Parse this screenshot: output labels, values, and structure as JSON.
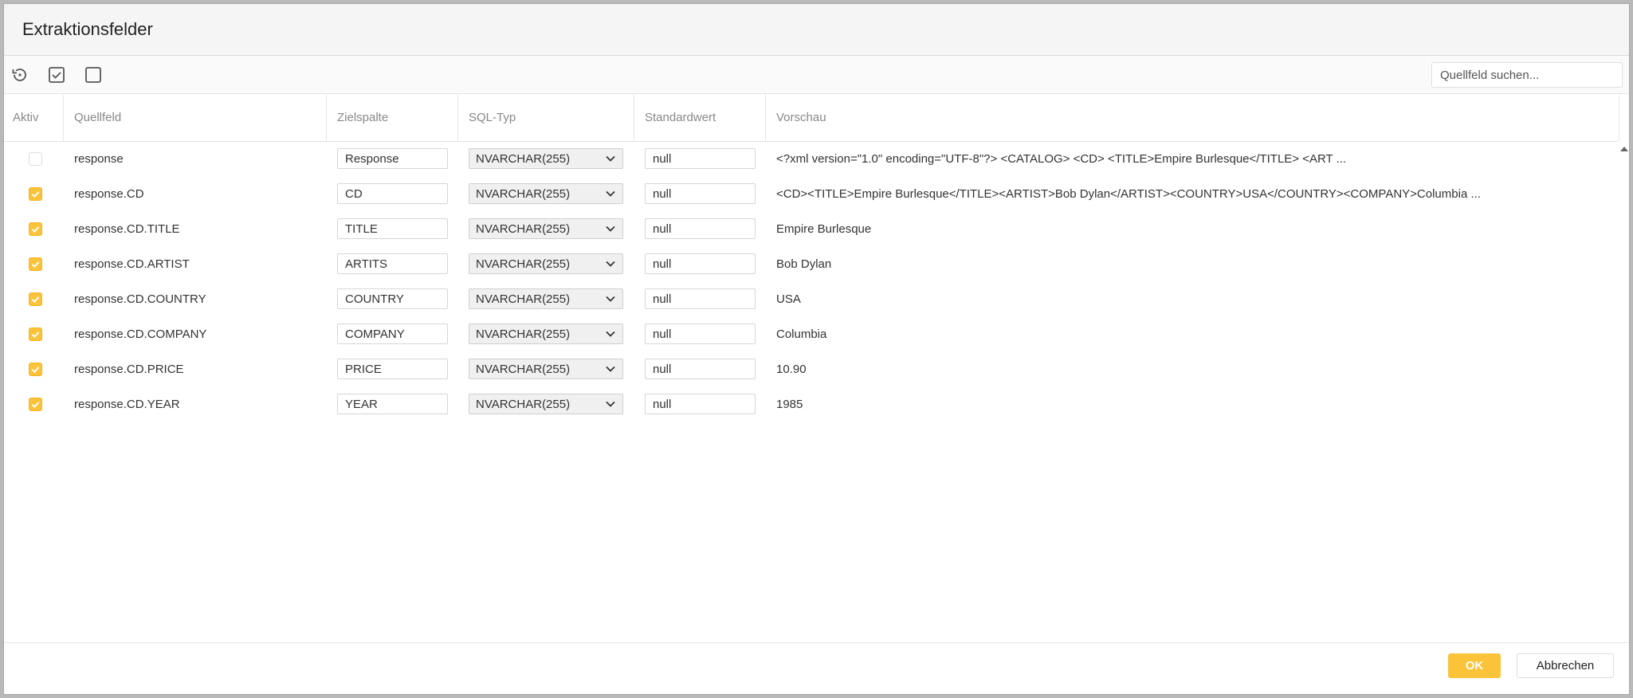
{
  "dialog": {
    "title": "Extraktionsfelder"
  },
  "toolbar": {
    "reset_icon": "reset-icon",
    "select_all_icon": "checkbox-checked-icon",
    "select_none_icon": "checkbox-empty-icon",
    "search_placeholder": "Quellfeld suchen..."
  },
  "columns": {
    "active": "Aktiv",
    "source": "Quellfeld",
    "target": "Zielspalte",
    "sqltype": "SQL-Typ",
    "default": "Standardwert",
    "preview": "Vorschau"
  },
  "rows": [
    {
      "active": false,
      "source": "response",
      "target": "Response",
      "sqltype": "NVARCHAR(255)",
      "default": "null",
      "preview": "<?xml version=\"1.0\" encoding=\"UTF-8\"?> <CATALOG> <CD> <TITLE>Empire Burlesque</TITLE> <ART ..."
    },
    {
      "active": true,
      "source": "response.CD",
      "target": "CD",
      "sqltype": "NVARCHAR(255)",
      "default": "null",
      "preview": "<CD><TITLE>Empire Burlesque</TITLE><ARTIST>Bob Dylan</ARTIST><COUNTRY>USA</COUNTRY><COMPANY>Columbia ..."
    },
    {
      "active": true,
      "source": "response.CD.TITLE",
      "target": "TITLE",
      "sqltype": "NVARCHAR(255)",
      "default": "null",
      "preview": "Empire Burlesque"
    },
    {
      "active": true,
      "source": "response.CD.ARTIST",
      "target": "ARTITS",
      "sqltype": "NVARCHAR(255)",
      "default": "null",
      "preview": "Bob Dylan"
    },
    {
      "active": true,
      "source": "response.CD.COUNTRY",
      "target": "COUNTRY",
      "sqltype": "NVARCHAR(255)",
      "default": "null",
      "preview": "USA"
    },
    {
      "active": true,
      "source": "response.CD.COMPANY",
      "target": "COMPANY",
      "sqltype": "NVARCHAR(255)",
      "default": "null",
      "preview": "Columbia"
    },
    {
      "active": true,
      "source": "response.CD.PRICE",
      "target": "PRICE",
      "sqltype": "NVARCHAR(255)",
      "default": "null",
      "preview": "10.90"
    },
    {
      "active": true,
      "source": "response.CD.YEAR",
      "target": "YEAR",
      "sqltype": "NVARCHAR(255)",
      "default": "null",
      "preview": "1985"
    }
  ],
  "footer": {
    "ok_label": "OK",
    "cancel_label": "Abbrechen"
  },
  "colors": {
    "accent": "#fbc33a"
  }
}
